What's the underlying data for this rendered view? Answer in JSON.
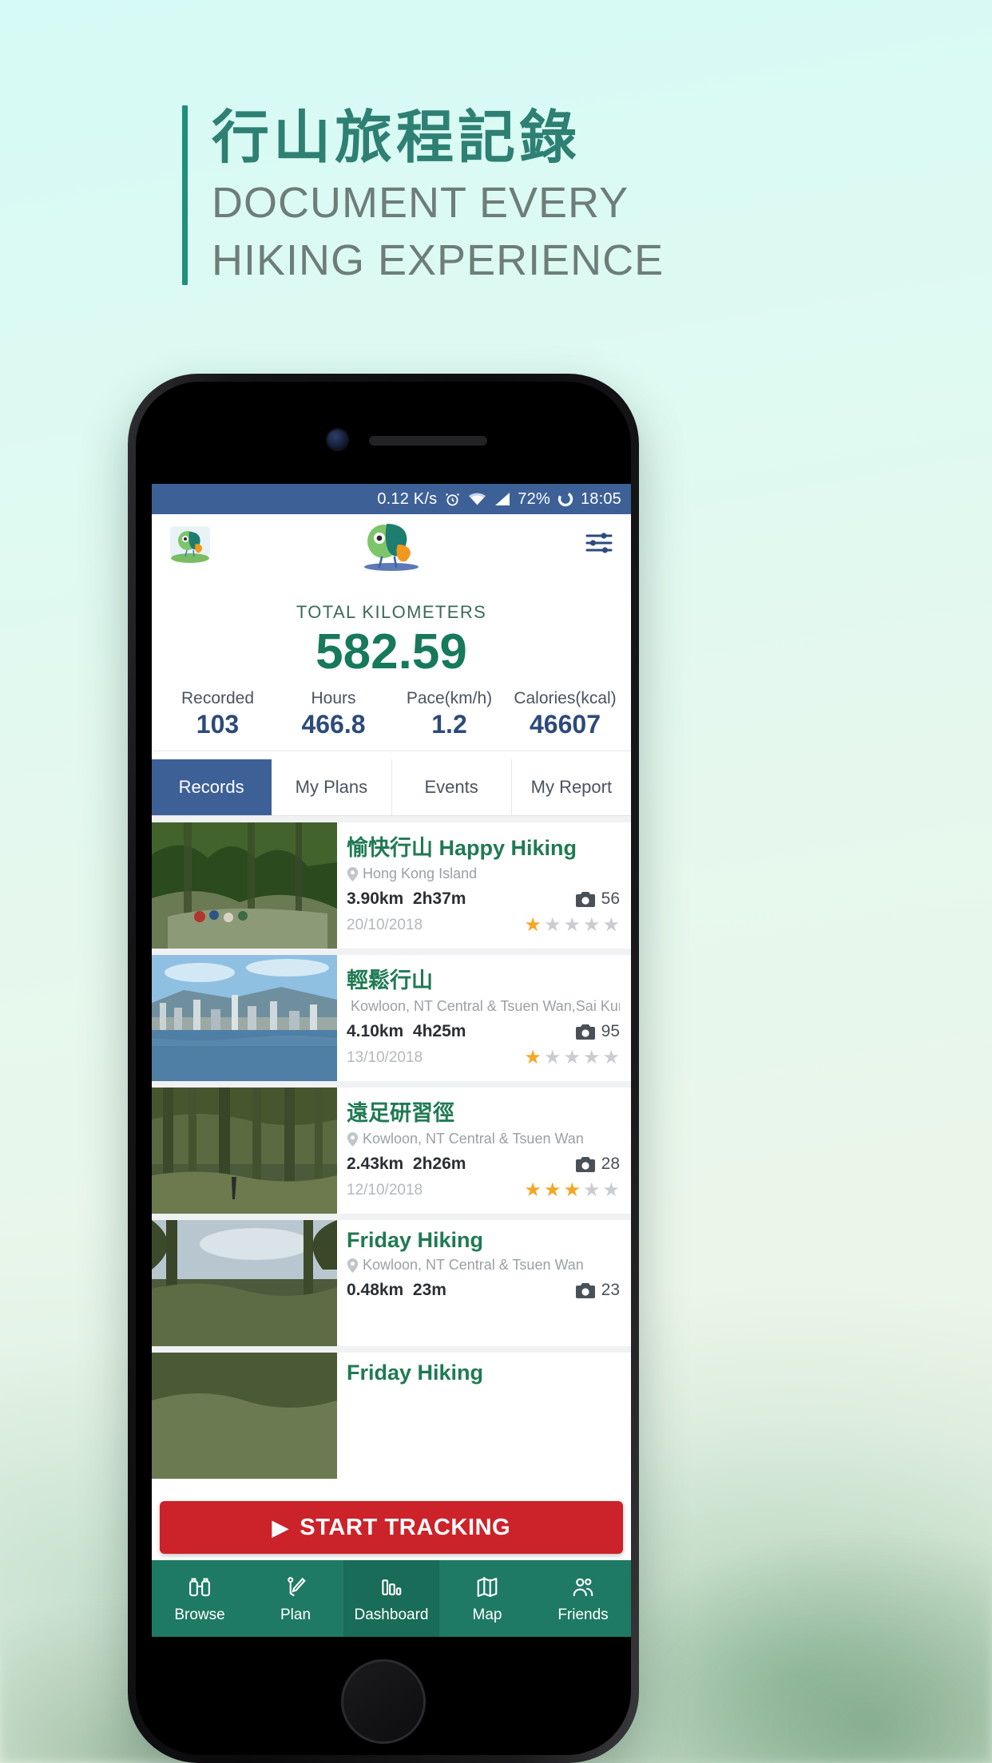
{
  "promo": {
    "headline_zh": "行山旅程記錄",
    "headline_en_line1": "DOCUMENT EVERY",
    "headline_en_line2": "HIKING EXPERIENCE",
    "accent_color": "#2e8073",
    "rule_color": "#1d8f7a"
  },
  "statusbar": {
    "network_speed": "0.12 K/s",
    "alarm_icon": "alarm-clock-icon",
    "wifi_icon": "wifi-icon",
    "signal_icon": "cell-signal-icon",
    "battery_percent": "72%",
    "battery_icon": "battery-circle-icon",
    "time": "18:05",
    "background": "#3d6097"
  },
  "app_header": {
    "brand_thumb": "app-logo-bird-icon",
    "center_logo": "app-logo-bird-icon",
    "settings_icon": "sliders-settings-icon"
  },
  "stats": {
    "total_label": "TOTAL KILOMETERS",
    "total_value": "582.59",
    "total_color": "#17795c",
    "cells": [
      {
        "title": "Recorded",
        "value": "103"
      },
      {
        "title": "Hours",
        "value": "466.8"
      },
      {
        "title": "Pace(km/h)",
        "value": "1.2"
      },
      {
        "title": "Calories(kcal)",
        "value": "46607"
      }
    ]
  },
  "tabs": [
    {
      "label": "Records",
      "active": true
    },
    {
      "label": "My Plans",
      "active": false
    },
    {
      "label": "Events",
      "active": false
    },
    {
      "label": "My Report",
      "active": false
    }
  ],
  "records": [
    {
      "title": "愉快行山 Happy Hiking",
      "location": "Hong Kong Island",
      "distance": "3.90km",
      "duration": "2h37m",
      "photos": "56",
      "date": "20/10/2018",
      "rating": 1,
      "thumb": "forest-trail-hikers-photo"
    },
    {
      "title": "輕鬆行山",
      "location": "Kowloon, NT Central & Tsuen Wan,Sai Kung, TK...",
      "distance": "4.10km",
      "duration": "4h25m",
      "photos": "95",
      "date": "13/10/2018",
      "rating": 1,
      "thumb": "harbour-skyline-photo"
    },
    {
      "title": "遠足研習徑",
      "location": "Kowloon, NT Central & Tsuen Wan",
      "distance": "2.43km",
      "duration": "2h26m",
      "photos": "28",
      "date": "12/10/2018",
      "rating": 3,
      "thumb": "pine-forest-photo"
    },
    {
      "title": "Friday Hiking",
      "location": "Kowloon, NT Central & Tsuen Wan",
      "distance": "0.48km",
      "duration": "23m",
      "photos": "23",
      "date": "",
      "rating": 0,
      "thumb": "woodland-sky-photo"
    }
  ],
  "start_tracking": {
    "label": "START TRACKING",
    "play_icon": "play-triangle-icon",
    "color": "#cc2229"
  },
  "bottom_nav": {
    "background": "#1f7a63",
    "items": [
      {
        "label": "Browse",
        "icon": "binoculars-icon",
        "active": false
      },
      {
        "label": "Plan",
        "icon": "pin-pen-icon",
        "active": false
      },
      {
        "label": "Dashboard",
        "icon": "bar-chart-icon",
        "active": true
      },
      {
        "label": "Map",
        "icon": "folded-map-icon",
        "active": false
      },
      {
        "label": "Friends",
        "icon": "people-icon",
        "active": false
      }
    ]
  }
}
